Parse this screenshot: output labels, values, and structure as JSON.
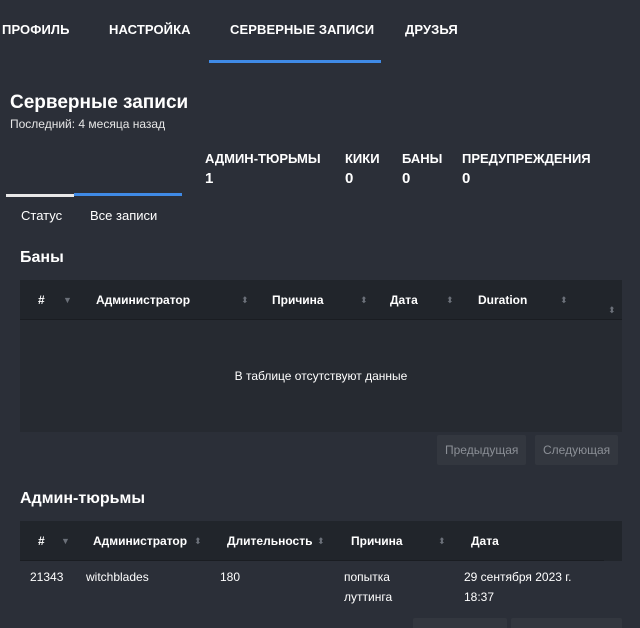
{
  "nav": {
    "tabs": [
      {
        "label": "ПРОФИЛЬ"
      },
      {
        "label": "НАСТРОЙКА"
      },
      {
        "label": "СЕРВЕРНЫЕ ЗАПИСИ"
      },
      {
        "label": "ДРУЗЬЯ"
      }
    ],
    "active_index": 2
  },
  "header": {
    "title": "Серверные записи",
    "subtitle": "Последний: 4 месяца назад"
  },
  "stats": [
    {
      "label": "АДМИН-ТЮРЬМЫ",
      "value": "1"
    },
    {
      "label": "КИКИ",
      "value": "0"
    },
    {
      "label": "БАНЫ",
      "value": "0"
    },
    {
      "label": "ПРЕДУПРЕЖДЕНИЯ",
      "value": "0"
    }
  ],
  "subtabs": [
    {
      "label": "Статус"
    },
    {
      "label": "Все записи"
    }
  ],
  "bans": {
    "title": "Баны",
    "columns": [
      "#",
      "Администратор",
      "Причина",
      "Дата",
      "Duration"
    ],
    "empty_text": "В таблице отсутствуют данные",
    "prev_label": "Предыдущая",
    "next_label": "Следующая"
  },
  "jails": {
    "title": "Админ-тюрьмы",
    "columns": [
      "#",
      "Администратор",
      "Длительность",
      "Причина",
      "Дата"
    ],
    "rows": [
      {
        "id": "21343",
        "admin": "witchblades",
        "duration": "180",
        "reason": "попытка луттинга",
        "date": "29 сентября 2023 г. 18:37"
      }
    ]
  },
  "colors": {
    "background": "#2b2f38",
    "accent": "#3f8ae6",
    "table_header": "#21252b"
  }
}
